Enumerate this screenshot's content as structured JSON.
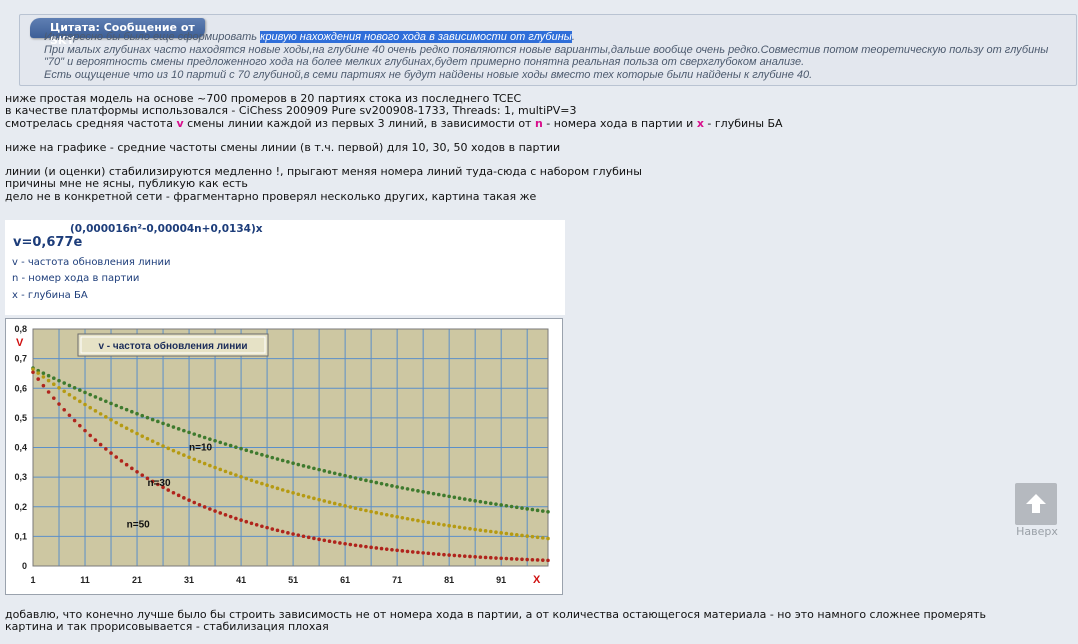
{
  "quote": {
    "title": "Цитата: Сообщение от SKY",
    "line1_pre": "Интересно бы было еще сформировать ",
    "line1_highlight": "кривую нахождения нового хода в зависимости от глубины",
    "line1_post": ".",
    "line2": "При малых глубинах часто находятся новые ходы,на глубине 40 очень редко появляются новые варианты,дальше вообще очень редко.Совместив потом теоретическую пользу от глубины",
    "line3": "\"70\" и вероятность смены предложенного хода на более мелких глубинах,будет примерно понятна реальная польза от сверхглубоком анализе.",
    "line4": "Есть ощущение что из 10 партий с 70 глубиной,в семи партиях не будут найдены новые ходы вместо тех которые были найдены к глубине 40."
  },
  "post": {
    "p1": "ниже простая модель на основе ~700 промеров в 20 партиях стока из последнего TCEC",
    "p2": "в качестве платформы использовался - CiChess 200909 Pure sv200908-1733, Threads: 1, multiPV=3",
    "p3_a": "смотрелась средняя частота ",
    "p3_v": "v",
    "p3_b": " смены линии каждой из первых 3 линий, в зависимости от ",
    "p3_n": "n",
    "p3_c": " - номера хода в партии и ",
    "p3_x": "x",
    "p3_d": " - глубины БА",
    "p4": "ниже на графике - средние частоты смены линии (в т.ч. первой) для 10, 30, 50 ходов в партии",
    "p5": "линии (и оценки) стабилизируются медленно !, прыгают меняя номера линий туда-сюда с набором глубины",
    "p6": "причины мне не ясны, публикую как есть",
    "p7": "дело не в конкретной сети - фрагментарно проверял несколько других, картина такая же"
  },
  "formula": {
    "exponent": "(0,000016n²-0,00004n+0,0134)x",
    "main": "v=0,677e",
    "def_v": "v - частота обновления линии",
    "def_n": "n - номер хода в партии",
    "def_x": "x - глубина БА"
  },
  "footer": {
    "p1": "добавлю, что конечно лучше было бы строить зависимость не от номера хода в партии, а от количества остающегося материала - но это намного сложнее промерять",
    "p2": "картина и так прорисовывается - стабилизация плохая"
  },
  "scroll_top": {
    "label": "Наверх",
    "icon": "arrow-up-icon"
  },
  "colors": {
    "plot_bg": "#cdc7a2",
    "grid": "#5b8fc9",
    "n10": "#3e7a2e",
    "n30": "#b59a12",
    "n50": "#b0241c",
    "axis_letter": "#d01010"
  },
  "chart_data": {
    "type": "scatter",
    "legend_box": "v - частота обновления линии",
    "xlabel": "X",
    "ylabel": "V",
    "xlim": [
      1,
      100
    ],
    "ylim": [
      0,
      0.8
    ],
    "x_ticks": [
      "1",
      "11",
      "21",
      "31",
      "41",
      "51",
      "61",
      "71",
      "81",
      "91"
    ],
    "y_ticks": [
      "0",
      "0,1",
      "0,2",
      "0,3",
      "0,4",
      "0,5",
      "0,6",
      "0,7",
      "0,8"
    ],
    "grid": true,
    "formula": "v = 0.677 * exp(-(0.000016 n^2 - 0.00004 n + 0.0134) x)",
    "x": [
      1,
      11,
      21,
      31,
      41,
      51,
      61,
      71,
      81,
      91,
      100
    ],
    "series": [
      {
        "name": "n=10",
        "values": [
          0.668,
          0.586,
          0.514,
          0.451,
          0.396,
          0.347,
          0.305,
          0.267,
          0.235,
          0.206,
          0.183
        ]
      },
      {
        "name": "n=30",
        "values": [
          0.664,
          0.545,
          0.447,
          0.367,
          0.301,
          0.247,
          0.203,
          0.166,
          0.136,
          0.112,
          0.093
        ]
      },
      {
        "name": "n=50",
        "values": [
          0.654,
          0.457,
          0.318,
          0.222,
          0.155,
          0.108,
          0.075,
          0.053,
          0.037,
          0.026,
          0.019
        ]
      }
    ]
  }
}
